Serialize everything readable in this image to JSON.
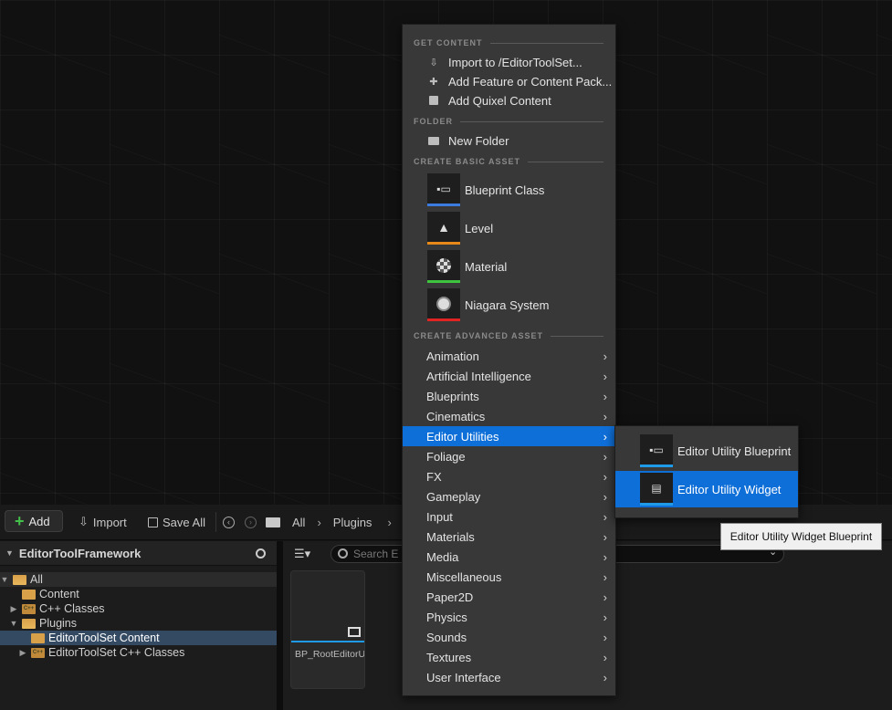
{
  "toolbar": {
    "add_label": "Add",
    "import_label": "Import",
    "save_all_label": "Save All",
    "breadcrumb": [
      "All",
      "Plugins"
    ]
  },
  "sidebar": {
    "title": "EditorToolFramework",
    "tree": [
      {
        "label": "All"
      },
      {
        "label": "Content"
      },
      {
        "label": "C++ Classes"
      },
      {
        "label": "Plugins"
      },
      {
        "label": "EditorToolSet Content"
      },
      {
        "label": "EditorToolSet C++ Classes"
      }
    ]
  },
  "grid": {
    "search_placeholder": "Search E",
    "asset": {
      "label": "BP_RootEditorUtility"
    }
  },
  "menu": {
    "sections": {
      "get_content": "GET CONTENT",
      "folder": "FOLDER",
      "basic": "CREATE BASIC ASSET",
      "advanced": "CREATE ADVANCED ASSET"
    },
    "get_content_items": [
      "Import to /EditorToolSet...",
      "Add Feature or Content Pack...",
      "Add Quixel Content"
    ],
    "folder_items": [
      "New Folder"
    ],
    "basic_items": [
      {
        "label": "Blueprint Class",
        "icon": "blueprint-icon",
        "color": "#3b7be0"
      },
      {
        "label": "Level",
        "icon": "level-icon",
        "color": "#e88a1a"
      },
      {
        "label": "Material",
        "icon": "material-icon",
        "color": "#3ec43e"
      },
      {
        "label": "Niagara System",
        "icon": "niagara-icon",
        "color": "#e02424"
      }
    ],
    "advanced_items": [
      "Animation",
      "Artificial Intelligence",
      "Blueprints",
      "Cinematics",
      "Editor Utilities",
      "Foliage",
      "FX",
      "Gameplay",
      "Input",
      "Materials",
      "Media",
      "Miscellaneous",
      "Paper2D",
      "Physics",
      "Sounds",
      "Textures",
      "User Interface"
    ],
    "highlighted": "Editor Utilities"
  },
  "submenu": {
    "items": [
      "Editor Utility Blueprint",
      "Editor Utility Widget"
    ],
    "highlighted": "Editor Utility Widget"
  },
  "tooltip": "Editor Utility Widget Blueprint"
}
